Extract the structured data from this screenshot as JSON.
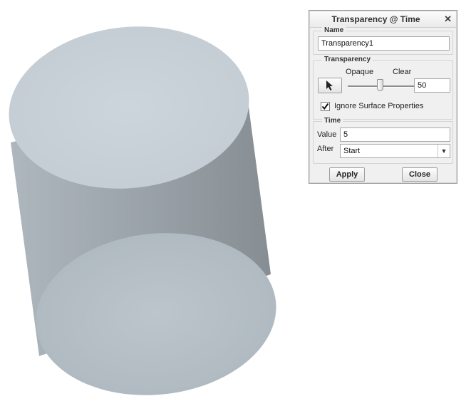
{
  "dialog": {
    "title": "Transparency @ Time",
    "close_icon": "close-icon"
  },
  "name_group": {
    "label": "Name",
    "value": "Transparency1"
  },
  "transparency_group": {
    "label": "Transparency",
    "picker_icon": "pointer-arrow-icon",
    "opaque_label": "Opaque",
    "clear_label": "Clear",
    "value": "50",
    "slider_fraction": 0.5,
    "ignore_label": "Ignore Surface Properties",
    "ignore_checked": true
  },
  "time_group": {
    "label": "Time",
    "value_label": "Value",
    "value": "5",
    "after_label": "After",
    "after_selected": "Start"
  },
  "buttons": {
    "apply": "Apply",
    "close": "Close"
  },
  "model": {
    "shape": "cylinder",
    "color": "#b5bfc6"
  }
}
